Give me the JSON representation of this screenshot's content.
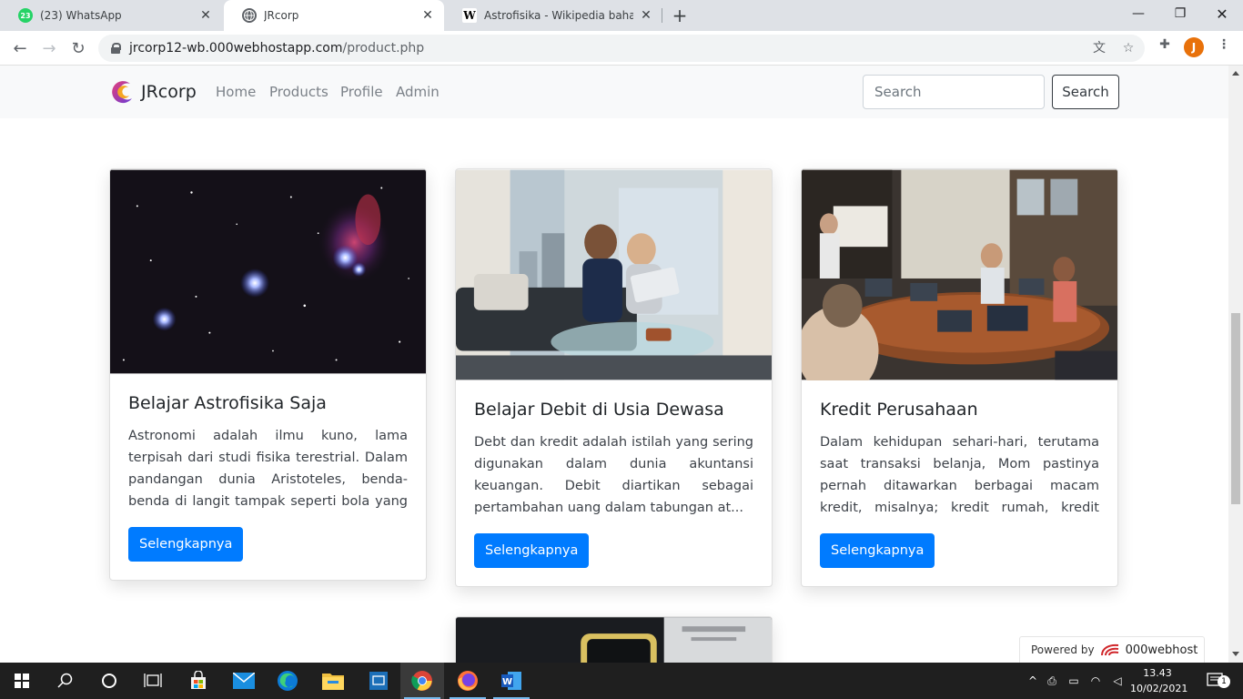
{
  "browser": {
    "tabs": [
      {
        "title": "(23) WhatsApp",
        "badge": "23",
        "icon": "whatsapp-icon",
        "active": false
      },
      {
        "title": "JRcorp",
        "icon": "globe-icon",
        "active": true
      },
      {
        "title": "Astrofisika - Wikipedia bahasa Indonesia",
        "icon": "wikipedia-icon",
        "active": false
      }
    ],
    "url_host": "jrcorp12-wb.000webhostapp.com",
    "url_path": "/product.php",
    "profile_initial": "J"
  },
  "navbar": {
    "brand": "JRcorp",
    "links": [
      "Home",
      "Products",
      "Profile",
      "Admin"
    ],
    "search_placeholder": "Search",
    "search_button": "Search"
  },
  "products": [
    {
      "title": "Belajar Astrofisika Saja",
      "text": "Astronomi adalah ilmu kuno, lama terpisah dari studi fisika terestrial. Dalam pandangan dunia Aristoteles, benda-benda di langit tampak seperti bola yang tid...",
      "button": "Selengkapnya",
      "image": "orion-nebula-starfield"
    },
    {
      "title": "Belajar Debit di Usia Dewasa",
      "text": "Debt dan kredit adalah istilah yang sering digunakan dalam dunia akuntansi keuangan. Debit diartikan sebagai pertambahan uang dalam tabungan at...",
      "button": "Selengkapnya",
      "image": "businessmen-with-laptop-on-sofa"
    },
    {
      "title": "Kredit Perusahaan",
      "text": "Dalam kehidupan sehari-hari, terutama saat transaksi belanja, Mom pastinya pernah ditawarkan berbagai macam kredit, misalnya; kredit rumah, kredit kendara...",
      "button": "Selengkapnya",
      "image": "meeting-room-presentation"
    }
  ],
  "powered_by": {
    "label": "Powered by",
    "name": "000webhost"
  },
  "taskbar": {
    "time": "13.43",
    "date": "10/02/2021",
    "notifications": "1"
  }
}
